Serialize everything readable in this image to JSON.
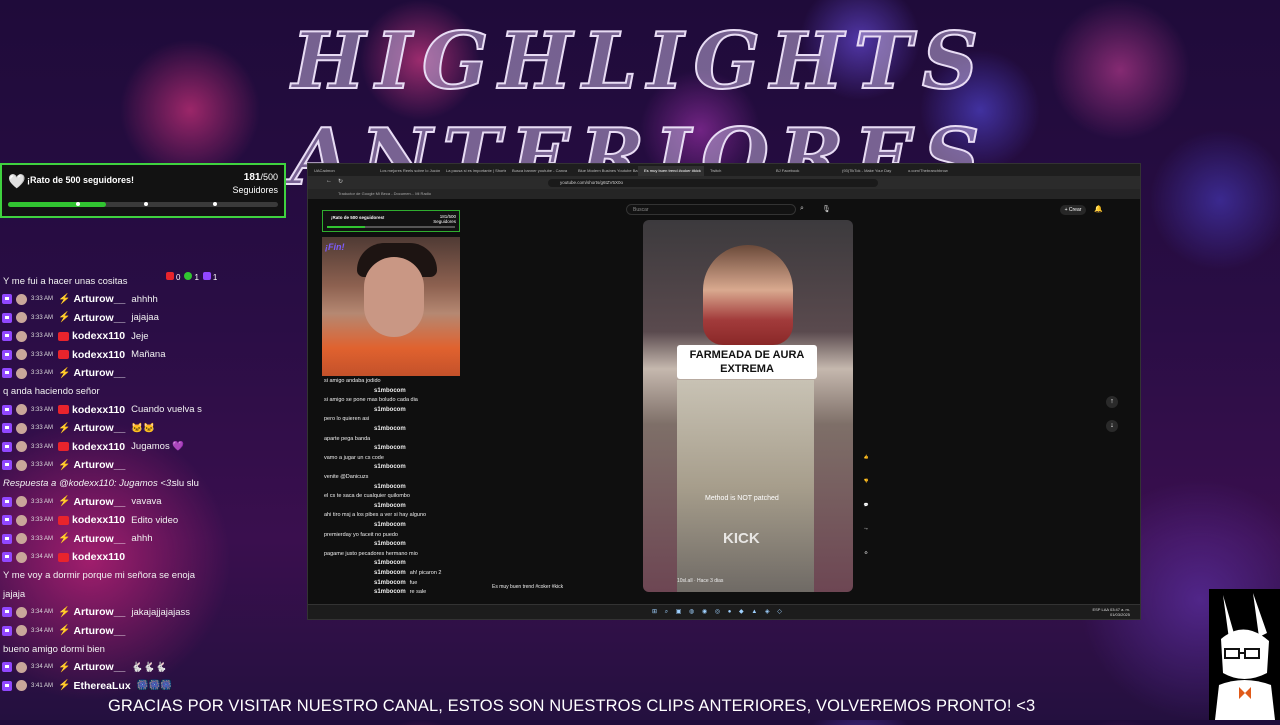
{
  "header": {
    "title": "HIGHLIGHTS ANTERIORES"
  },
  "goal": {
    "label": "¡Rato de 500 seguidores!",
    "current": "181",
    "target": "/500",
    "unit": "Seguidores",
    "progress": 0.362
  },
  "chat_stats": {
    "youtube": "0",
    "kick": "1",
    "twitch": "1"
  },
  "chat": [
    {
      "type": "text",
      "text": "Y me fui a hacer unas cositas"
    },
    {
      "type": "msg",
      "time": "3:33 AM",
      "platform": "twitch",
      "user": "Arturow__",
      "message": "ahhhh"
    },
    {
      "type": "msg",
      "time": "3:33 AM",
      "platform": "twitch",
      "user": "Arturow__",
      "message": "jajajaa"
    },
    {
      "type": "msg",
      "time": "3:33 AM",
      "platform": "kick",
      "user": "kodexx110",
      "message": "Jeje"
    },
    {
      "type": "msg",
      "time": "3:33 AM",
      "platform": "kick",
      "user": "kodexx110",
      "message": "Mañana"
    },
    {
      "type": "msg",
      "time": "3:33 AM",
      "platform": "twitch",
      "user": "Arturow__",
      "message": ""
    },
    {
      "type": "text",
      "text": "q anda haciendo señor"
    },
    {
      "type": "msg",
      "time": "3:33 AM",
      "platform": "kick",
      "user": "kodexx110",
      "message": "Cuando vuelva s"
    },
    {
      "type": "msg",
      "time": "3:33 AM",
      "platform": "twitch",
      "user": "Arturow__",
      "message": "🐱🐱"
    },
    {
      "type": "msg",
      "time": "3:33 AM",
      "platform": "kick",
      "user": "kodexx110",
      "message": "Jugamos 💜"
    },
    {
      "type": "msg",
      "time": "3:33 AM",
      "platform": "twitch",
      "user": "Arturow__",
      "message": ""
    },
    {
      "type": "reply",
      "text": "Respuesta a @kodexx110: Jugamos <3:",
      "tail": " slu slu"
    },
    {
      "type": "msg",
      "time": "3:33 AM",
      "platform": "twitch",
      "user": "Arturow__",
      "message": "vavava"
    },
    {
      "type": "msg",
      "time": "3:33 AM",
      "platform": "kick",
      "user": "kodexx110",
      "message": "Edito video"
    },
    {
      "type": "msg",
      "time": "3:33 AM",
      "platform": "twitch",
      "user": "Arturow__",
      "message": "ahhh"
    },
    {
      "type": "msg",
      "time": "3:34 AM",
      "platform": "kick",
      "user": "kodexx110",
      "message": ""
    },
    {
      "type": "text",
      "text": "Y me voy a dormir porque mi señora se enoja"
    },
    {
      "type": "text",
      "text": "jajaja"
    },
    {
      "type": "msg",
      "time": "3:34 AM",
      "platform": "twitch",
      "user": "Arturow__",
      "message": "jakajajjajajass"
    },
    {
      "type": "msg",
      "time": "3:34 AM",
      "platform": "twitch",
      "user": "Arturow__",
      "message": ""
    },
    {
      "type": "text",
      "text": "bueno amigo dormi bien"
    },
    {
      "type": "msg",
      "time": "3:34 AM",
      "platform": "twitch",
      "user": "Arturow__",
      "message": "🐇🐇🐇"
    },
    {
      "type": "msg",
      "time": "3:41 AM",
      "platform": "twitch",
      "user": "EthereaLux",
      "message": "🎆🎆🎆"
    }
  ],
  "browser": {
    "tabs": [
      "UACadmon",
      "Los mejores Reels sobre lo Jucón",
      "La pausa si es importante | Shorts",
      "Busca banner youtube - Canva",
      "Blue Modern Busines Youtube Ba",
      "Es muy buen trend #coker #kick",
      "Twitch",
      "BJ Facebook",
      "(93)TikTok - Make Your Day",
      "o.com/Thebranchbrow"
    ],
    "url": "youtube.com/shorts/g6tZV5X0o",
    "bookmarks": "Traductor de Google   Mi Beca - Documen...   Mi   Radio",
    "search_placeholder": "Buscar",
    "create_label": "+ Crear"
  },
  "short": {
    "caption": "FARMEADA DE AURA EXTREMA",
    "overlay_text": "Method is NOT patched",
    "watermark": "KICK",
    "channel": "10sl.all · Hace 3 dias",
    "dock_title": "Es muy buen trend #coker #kick",
    "side_actions": [
      "Like",
      "No me",
      "Comentar",
      "Compartir",
      "Remix"
    ]
  },
  "inner_stream": {
    "goal_label": "¡Rato de 500 seguidores!",
    "goal_count": "181/500",
    "goal_unit": "Seguidores",
    "webcam_label": "¡Fin!",
    "chat": [
      {
        "user": "",
        "text": "si amigo andaba jodido"
      },
      {
        "user": "s1mbocom",
        "text": ""
      },
      {
        "user": "",
        "text": "si amigo se pone mas boludo cada dia"
      },
      {
        "user": "s1mbocom",
        "text": ""
      },
      {
        "user": "",
        "text": "pero lo quieren asi"
      },
      {
        "user": "s1mbocom",
        "text": ""
      },
      {
        "user": "",
        "text": "aparte pega banda"
      },
      {
        "user": "s1mbocom",
        "text": ""
      },
      {
        "user": "",
        "text": "vamo a jugar un cs code"
      },
      {
        "user": "s1mbocom",
        "text": ""
      },
      {
        "user": "",
        "text": "venite @Danicuzs"
      },
      {
        "user": "s1mbocom",
        "text": ""
      },
      {
        "user": "",
        "text": "el cs te saca de cualquier quilombo"
      },
      {
        "user": "s1mbocom",
        "text": ""
      },
      {
        "user": "",
        "text": "ahi tiro msj a los pibes a ver si hay alguno"
      },
      {
        "user": "s1mbocom",
        "text": ""
      },
      {
        "user": "",
        "text": "premierday yo faceit no puedo"
      },
      {
        "user": "s1mbocom",
        "text": ""
      },
      {
        "user": "",
        "text": "pagame justo pecadores hermano mio"
      },
      {
        "user": "s1mbocom",
        "text": ""
      },
      {
        "user": "s1mbocom",
        "text": "ah! picaron 2"
      },
      {
        "user": "s1mbocom",
        "text": "fue"
      },
      {
        "user": "s1mbocom",
        "text": "re sale"
      }
    ]
  },
  "taskbar": {
    "time": "03:47 a. m.",
    "date": "01/03/2025",
    "lang": "ESP LAA"
  },
  "footer": {
    "banner": "GRACIAS POR VISITAR NUESTRO CANAL, ESTOS SON NUESTROS CLIPS ANTERIORES, VOLVEREMOS PRONTO!  <3"
  },
  "colors": {
    "goal_green": "#31c431",
    "kick_red": "#e8242c",
    "twitch_purple": "#9147ff"
  }
}
